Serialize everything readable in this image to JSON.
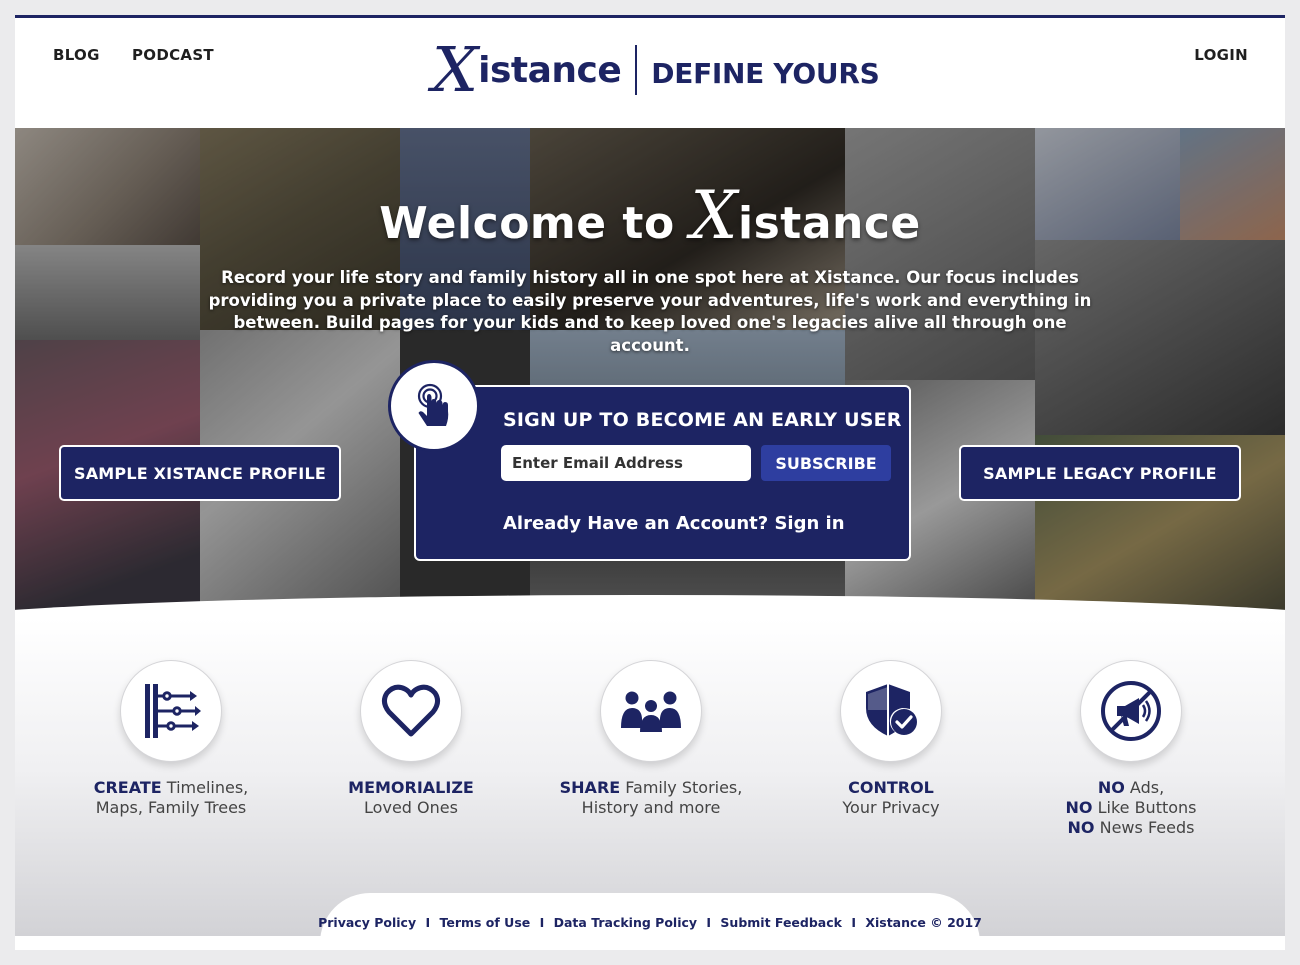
{
  "header": {
    "nav_blog": "BLOG",
    "nav_podcast": "PODCAST",
    "nav_login": "LOGIN",
    "logo_x": "X",
    "logo_word": "istance",
    "logo_tagline": "DEFINE YOURS"
  },
  "hero": {
    "welcome_prefix": "Welcome to",
    "welcome_x": "X",
    "welcome_word": "istance",
    "intro": "Record your life story and family history all in one spot here at Xistance. Our focus includes providing you a private place to easily preserve your adventures, life's work and everything in between. Build pages for your kids and to keep loved one's legacies alive all through one account.",
    "sample_left": "SAMPLE XISTANCE PROFILE",
    "sample_right": "SAMPLE LEGACY PROFILE"
  },
  "signup": {
    "title": "SIGN UP TO BECOME AN EARLY USER",
    "email_placeholder": "Enter Email Address",
    "subscribe": "SUBSCRIBE",
    "signin": "Already Have an Account? Sign in"
  },
  "features": [
    {
      "bold": "CREATE",
      "rest": " Timelines,",
      "line2": "Maps, Family Trees",
      "icon": "timeline-icon"
    },
    {
      "bold": "MEMORIALIZE",
      "rest": "",
      "line2": "Loved Ones",
      "icon": "heart-icon"
    },
    {
      "bold": "SHARE",
      "rest": " Family Stories,",
      "line2": "History and more",
      "icon": "family-icon"
    },
    {
      "bold": "CONTROL",
      "rest": "",
      "line2": "Your Privacy",
      "icon": "shield-check-icon"
    },
    {
      "bold1": "NO",
      "rest1": " Ads,",
      "bold2": "NO",
      "rest2": " Like Buttons",
      "bold3": "NO",
      "rest3": " News Feeds",
      "icon": "no-megaphone-icon"
    }
  ],
  "footer": {
    "privacy": "Privacy Policy",
    "terms": "Terms of Use",
    "tracking": "Data Tracking Policy",
    "feedback": "Submit Feedback",
    "copyright": "Xistance © 2017",
    "separator": "I"
  },
  "colors": {
    "navy": "#1d2463",
    "button_blue": "#2e3ea0"
  }
}
